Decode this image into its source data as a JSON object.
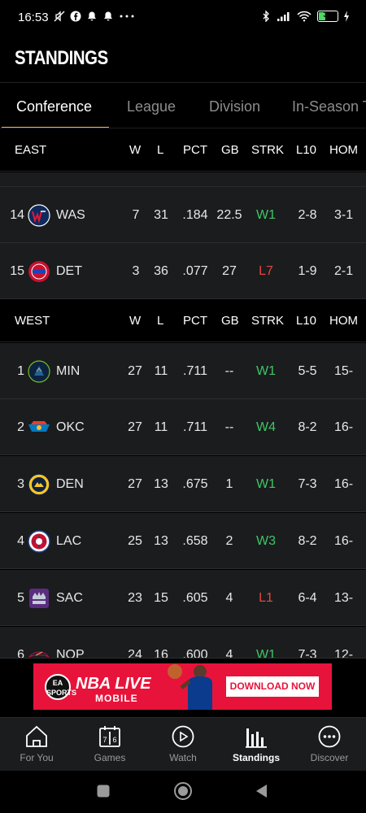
{
  "status_bar": {
    "time": "16:53",
    "battery": "37",
    "battery_level": 0.37
  },
  "header": {
    "title": "STANDINGS"
  },
  "tabs": [
    {
      "label": "Conference",
      "active": true
    },
    {
      "label": "League",
      "active": false
    },
    {
      "label": "Division",
      "active": false
    },
    {
      "label": "In-Season T",
      "active": false
    }
  ],
  "columns": [
    "W",
    "L",
    "PCT",
    "GB",
    "STRK",
    "L10",
    "HOM"
  ],
  "east": {
    "header": "EAST",
    "rows": [
      {
        "rank": "14",
        "team": "WAS",
        "w": "7",
        "l": "31",
        "pct": ".184",
        "gb": "22.5",
        "strk": "W1",
        "l10": "2-8",
        "home": "3-1"
      },
      {
        "rank": "15",
        "team": "DET",
        "w": "3",
        "l": "36",
        "pct": ".077",
        "gb": "27",
        "strk": "L7",
        "l10": "1-9",
        "home": "2-1"
      }
    ]
  },
  "west": {
    "header": "WEST",
    "rows": [
      {
        "rank": "1",
        "team": "MIN",
        "w": "27",
        "l": "11",
        "pct": ".711",
        "gb": "--",
        "strk": "W1",
        "l10": "5-5",
        "home": "15-"
      },
      {
        "rank": "2",
        "team": "OKC",
        "w": "27",
        "l": "11",
        "pct": ".711",
        "gb": "--",
        "strk": "W4",
        "l10": "8-2",
        "home": "16-"
      },
      {
        "rank": "3",
        "team": "DEN",
        "w": "27",
        "l": "13",
        "pct": ".675",
        "gb": "1",
        "strk": "W1",
        "l10": "7-3",
        "home": "16-"
      },
      {
        "rank": "4",
        "team": "LAC",
        "w": "25",
        "l": "13",
        "pct": ".658",
        "gb": "2",
        "strk": "W3",
        "l10": "8-2",
        "home": "16-"
      },
      {
        "rank": "5",
        "team": "SAC",
        "w": "23",
        "l": "15",
        "pct": ".605",
        "gb": "4",
        "strk": "L1",
        "l10": "6-4",
        "home": "13-"
      },
      {
        "rank": "6",
        "team": "NOP",
        "w": "24",
        "l": "16",
        "pct": ".600",
        "gb": "4",
        "strk": "W1",
        "l10": "7-3",
        "home": "12-"
      }
    ]
  },
  "ad": {
    "brand": "EA SPORTS",
    "title": "NBA LIVE",
    "subtitle": "MOBILE",
    "cta": "DOWNLOAD NOW"
  },
  "bottom_nav": [
    {
      "label": "For You",
      "icon": "home-icon",
      "active": false
    },
    {
      "label": "Games",
      "icon": "games-icon",
      "active": false
    },
    {
      "label": "Watch",
      "icon": "play-icon",
      "active": false
    },
    {
      "label": "Standings",
      "icon": "standings-icon",
      "active": true
    },
    {
      "label": "Discover",
      "icon": "discover-icon",
      "active": false
    }
  ],
  "team_colors": {
    "WAS": "#0f2a5c",
    "DET": "#c8102e",
    "MIN": "#0c2340",
    "OKC": "#007ac1",
    "DEN": "#0e2240",
    "LAC": "#ffffff",
    "SAC": "#5a2d81",
    "NOP": "#0c2340"
  },
  "colors": {
    "accent": "#f4b942",
    "win": "#3cc864",
    "loss": "#e2483d",
    "ad": "#e8133a"
  }
}
